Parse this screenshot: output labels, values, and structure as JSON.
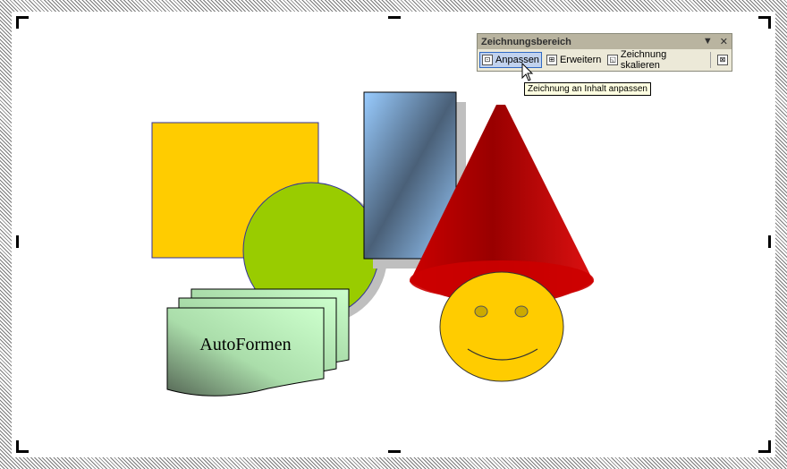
{
  "toolbar": {
    "title": "Zeichnungsbereich",
    "menu_glyph": "▼",
    "close_glyph": "✕",
    "buttons": [
      {
        "label": "Anpassen",
        "icon": "fit-drawing-icon"
      },
      {
        "label": "Erweitern",
        "icon": "expand-drawing-icon"
      },
      {
        "label": "Zeichnung skalieren",
        "icon": "scale-drawing-icon"
      }
    ],
    "wrap_icon": "text-wrap-icon"
  },
  "tooltip": "Zeichnung an Inhalt anpassen",
  "shapes": {
    "autoshape_text": "AutoFormen"
  },
  "colors": {
    "rectangle": "#ffcc00",
    "circle": "#99cc00",
    "cone": "#cc0000",
    "smiley": "#ffcc00",
    "wave_card": "#ccffcc"
  }
}
